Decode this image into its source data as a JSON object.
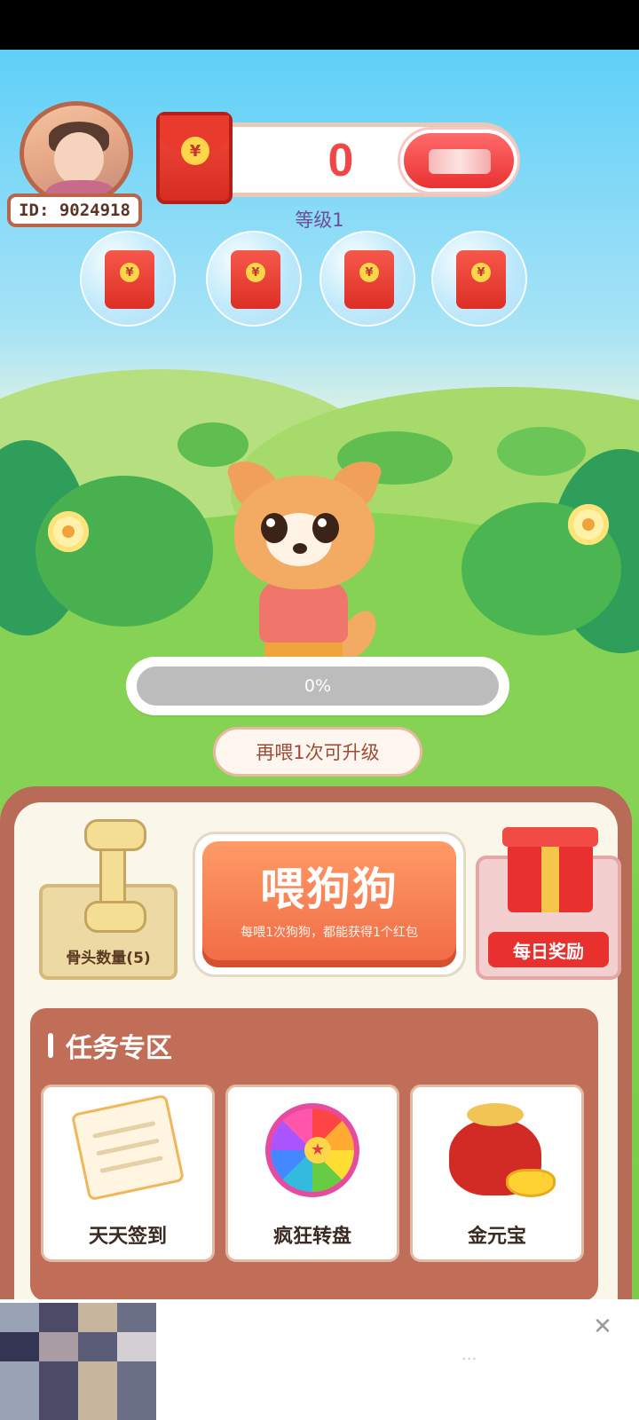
{
  "player": {
    "id_label": "ID: 9024918"
  },
  "balance": {
    "value": "0",
    "currency_symbol": "¥"
  },
  "level_label": "等级1",
  "bubbles": [
    {
      "symbol": "¥"
    },
    {
      "symbol": "¥"
    },
    {
      "symbol": "¥"
    },
    {
      "symbol": "¥"
    }
  ],
  "progress": {
    "value": 0,
    "label": "0%"
  },
  "upgrade_hint": "再喂1次可升级",
  "actions": {
    "bones_label": "骨头数量(5)",
    "feed_title": "喂狗狗",
    "feed_subtitle": "每喂1次狗狗，都能获得1个红包",
    "daily_label": "每日奖励"
  },
  "tasks": {
    "title": "任务专区",
    "items": [
      {
        "label": "天天签到",
        "icon": "notepad-pencil-icon"
      },
      {
        "label": "疯狂转盘",
        "icon": "prize-wheel-icon"
      },
      {
        "label": "金元宝",
        "icon": "gold-ingot-bag-icon"
      }
    ]
  },
  "ad": {
    "text": "...",
    "close_symbol": "✕"
  },
  "colors": {
    "accent": "#f06a45",
    "panel": "#b86b57",
    "task_panel": "#c06e58",
    "balance_text": "#f04848"
  }
}
